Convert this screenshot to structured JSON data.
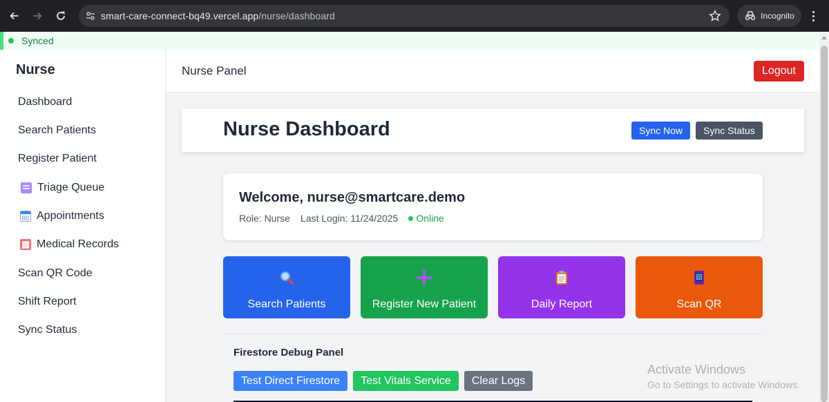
{
  "browser": {
    "url_host": "smart-care-connect-bq49.vercel.app",
    "url_path": "/nurse/dashboard",
    "incognito_label": "Incognito"
  },
  "sync_bar": {
    "label": "Synced"
  },
  "sidebar": {
    "brand": "Nurse",
    "items": [
      {
        "label": "Dashboard",
        "icon": ""
      },
      {
        "label": "Search Patients",
        "icon": ""
      },
      {
        "label": "Register Patient",
        "icon": ""
      },
      {
        "label": "Triage Queue",
        "icon": "triage-icon"
      },
      {
        "label": "Appointments",
        "icon": "calendar-icon"
      },
      {
        "label": "Medical Records",
        "icon": "clipboard-icon"
      },
      {
        "label": "Scan QR Code",
        "icon": ""
      },
      {
        "label": "Shift Report",
        "icon": ""
      },
      {
        "label": "Sync Status",
        "icon": ""
      }
    ]
  },
  "header": {
    "title": "Nurse Panel",
    "logout_label": "Logout"
  },
  "dashboard": {
    "title": "Nurse Dashboard",
    "sync_now_label": "Sync Now",
    "sync_status_label": "Sync Status"
  },
  "welcome": {
    "title": "Welcome, nurse@smartcare.demo",
    "role": "Role: Nurse",
    "last_login": "Last Login: 11/24/2025",
    "status": "Online"
  },
  "actions": [
    {
      "label": "Search Patients",
      "icon": "magnifier-icon",
      "color": "#2563eb"
    },
    {
      "label": "Register New Patient",
      "icon": "plus-icon",
      "color": "#16a34a"
    },
    {
      "label": "Daily Report",
      "icon": "clipboard-icon",
      "color": "#9333ea"
    },
    {
      "label": "Scan QR",
      "icon": "mobile-phone-icon",
      "color": "#ea580c"
    }
  ],
  "debug_panel": {
    "title": "Firestore Debug Panel",
    "buttons": [
      "Test Direct Firestore",
      "Test Vitals Service",
      "Clear Logs"
    ]
  },
  "watermark": {
    "line1": "Activate Windows",
    "line2": "Go to Settings to activate Windows."
  }
}
